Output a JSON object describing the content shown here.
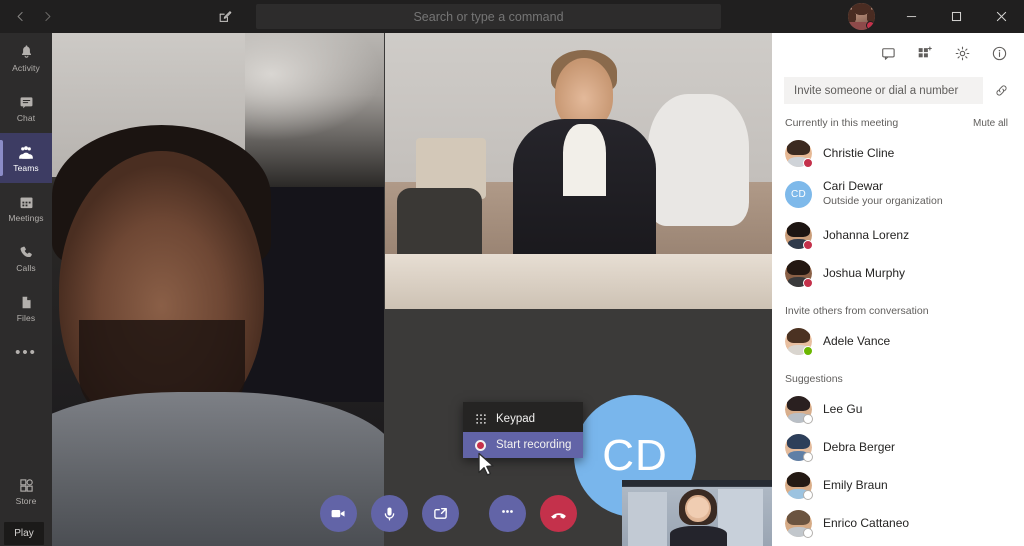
{
  "app": {
    "titlebar": {
      "back_icon": "chevron-left-icon",
      "forward_icon": "chevron-right-icon",
      "compose_icon": "compose-icon",
      "search_placeholder": "Search or type a command",
      "avatar_presence": "busy",
      "minimize_label": "Minimize",
      "maximize_label": "Maximize",
      "close_label": "Close",
      "accent": "#6264a7",
      "busy_color": "#c4314b"
    },
    "rail": {
      "items": [
        {
          "label": "Activity",
          "icon": "bell-icon",
          "selected": false
        },
        {
          "label": "Chat",
          "icon": "chat-icon",
          "selected": false
        },
        {
          "label": "Teams",
          "icon": "teams-icon",
          "selected": true
        },
        {
          "label": "Meetings",
          "icon": "calendar-icon",
          "selected": false
        },
        {
          "label": "Calls",
          "icon": "phone-icon",
          "selected": false
        },
        {
          "label": "Files",
          "icon": "file-icon",
          "selected": false
        }
      ],
      "more_label": "•••",
      "store": {
        "label": "Store",
        "icon": "store-icon"
      },
      "play_label": "Play",
      "selected_bg": "#3d3c63"
    },
    "stage": {
      "avatar_initials": "CD",
      "avatar_color": "#79b6ec",
      "tiles": [
        {
          "name": "participant-video-main"
        },
        {
          "name": "participant-video-secondary"
        },
        {
          "name": "participant-avatar-tile"
        },
        {
          "name": "self-view-pip"
        }
      ]
    },
    "controls": [
      {
        "name": "camera-button",
        "icon": "camera-icon",
        "label": "Turn camera off"
      },
      {
        "name": "microphone-button",
        "icon": "microphone-icon",
        "label": "Mute"
      },
      {
        "name": "share-screen-button",
        "icon": "share-screen-icon",
        "label": "Share"
      },
      {
        "name": "more-options-button",
        "icon": "ellipsis-icon",
        "label": "More options"
      },
      {
        "name": "hangup-button",
        "icon": "hangup-icon",
        "label": "Hang up"
      }
    ],
    "context_menu": {
      "items": [
        {
          "label": "Keypad",
          "icon": "keypad-icon",
          "highlighted": false
        },
        {
          "label": "Start recording",
          "icon": "record-icon",
          "highlighted": true
        }
      ],
      "highlight_color": "#6264a7"
    },
    "right_panel": {
      "header_icons": [
        {
          "name": "chat-icon",
          "label": "Show conversation"
        },
        {
          "name": "people-icon",
          "label": "Show participants"
        },
        {
          "name": "gear-icon",
          "label": "Settings"
        },
        {
          "name": "info-icon",
          "label": "Info"
        }
      ],
      "invite_placeholder": "Invite someone or dial a number",
      "invite_value": "",
      "link_icon": "link-icon",
      "sections": [
        {
          "title": "Currently in this meeting",
          "action": "Mute all",
          "people": [
            {
              "name": "Christie Cline",
              "sub": "",
              "type": "photo",
              "presence": "busy",
              "skin": "#e6b894",
              "hair": "#3c2a20",
              "body": "#cfd3d8"
            },
            {
              "name": "Cari Dewar",
              "sub": "Outside your organization",
              "type": "initials",
              "initials": "CD",
              "presence": "none",
              "color": "#7eb9ea"
            },
            {
              "name": "Johanna Lorenz",
              "sub": "",
              "type": "photo",
              "presence": "busy",
              "skin": "#c99c78",
              "hair": "#1d1512",
              "body": "#2f3a4a"
            },
            {
              "name": "Joshua Murphy",
              "sub": "",
              "type": "photo",
              "presence": "busy",
              "skin": "#8a6046",
              "hair": "#241812",
              "body": "#3a3a3c"
            }
          ]
        },
        {
          "title": "Invite others from conversation",
          "action": "",
          "people": [
            {
              "name": "Adele Vance",
              "sub": "",
              "type": "photo",
              "presence": "available",
              "skin": "#e8bfa0",
              "hair": "#4b3222",
              "body": "#d9d5cf"
            }
          ]
        },
        {
          "title": "Suggestions",
          "action": "",
          "people": [
            {
              "name": "Lee Gu",
              "sub": "",
              "type": "photo",
              "presence": "offline",
              "skin": "#d8ae8c",
              "hair": "#2a2020",
              "body": "#b9bfc6"
            },
            {
              "name": "Debra Berger",
              "sub": "",
              "type": "photo",
              "presence": "offline",
              "skin": "#e3bb9c",
              "hair": "#2d3f5a",
              "body": "#5f7fa6"
            },
            {
              "name": "Emily Braun",
              "sub": "",
              "type": "photo",
              "presence": "offline",
              "skin": "#d9ad88",
              "hair": "#241a14",
              "body": "#9cc3e0"
            },
            {
              "name": "Enrico Cattaneo",
              "sub": "",
              "type": "photo",
              "presence": "offline",
              "skin": "#d6ab86",
              "hair": "#6b5440",
              "body": "#c2c7cc"
            }
          ]
        }
      ]
    }
  }
}
